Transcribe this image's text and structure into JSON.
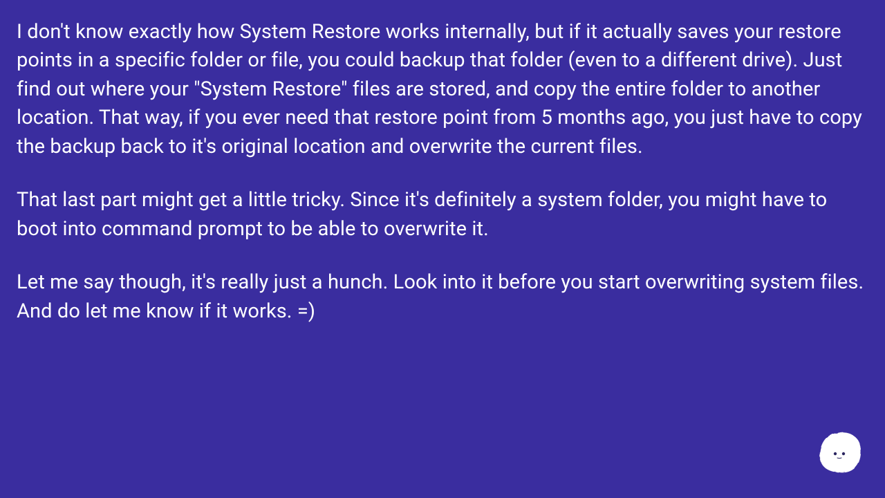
{
  "content": {
    "paragraphs": [
      "I don't know exactly how System Restore works internally, but if it actually saves your restore points in a specific folder or file, you could backup that folder (even to a different drive). Just find out where your \"System Restore\" files are stored, and copy the entire folder to another location. That way, if you ever need that restore point from 5 months ago, you just have to copy the backup back to it's original location and overwrite the current files.",
      "That last part might get a little tricky. Since it's definitely a system folder, you might have to boot into command prompt to be able to overwrite it.",
      "Let me say though, it's really just a hunch. Look into it before you start overwriting system files. And do let me know if it works. =)"
    ]
  },
  "colors": {
    "background": "#3a2d9f",
    "text": "#ffffff",
    "avatar_fill": "#ffffff",
    "avatar_eyes": "#2b2560"
  }
}
